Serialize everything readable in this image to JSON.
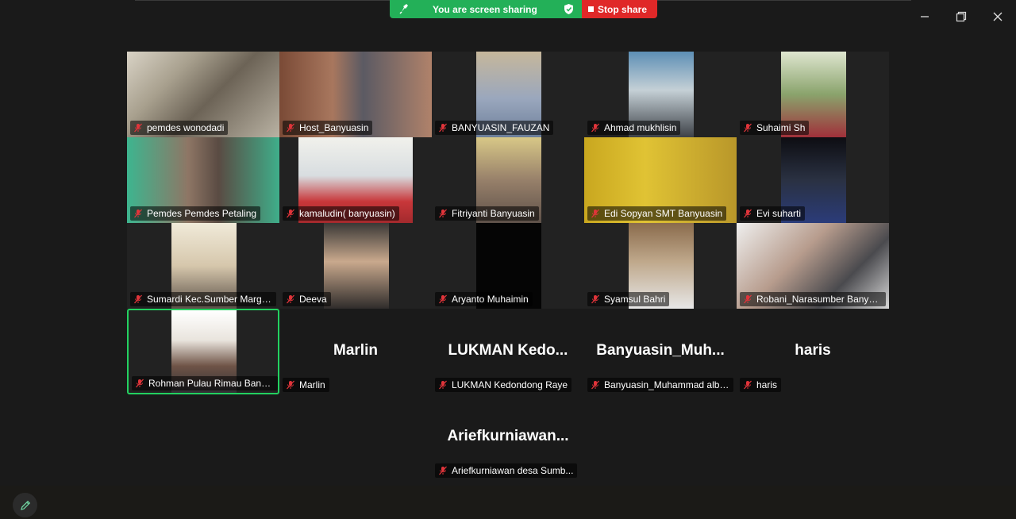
{
  "screen_share": {
    "status_text": "You are screen sharing",
    "stop_label": "Stop share"
  },
  "participants": [
    {
      "label": "pemdes wonodadi"
    },
    {
      "label": "Host_Banyuasin"
    },
    {
      "label": "BANYUASIN_FAUZAN"
    },
    {
      "label": "Ahmad mukhlisin"
    },
    {
      "label": "Suhaimi Sh"
    },
    {
      "label": "Pemdes Pemdes Petaling"
    },
    {
      "label": "kamaludin( banyuasin)"
    },
    {
      "label": "Fitriyanti Banyuasin"
    },
    {
      "label": "Edi Sopyan SMT Banyuasin"
    },
    {
      "label": "Evi suharti"
    },
    {
      "label": "Sumardi Kec.Sumber Marga ..."
    },
    {
      "label": "Deeva"
    },
    {
      "label": "Aryanto Muhaimin"
    },
    {
      "label": "Syamsul Bahri"
    },
    {
      "label": "Robani_Narasumber Banyuasin"
    },
    {
      "label": "Rohman Pulau Rimau Banyu..."
    },
    {
      "big": "Marlin",
      "label": "Marlin"
    },
    {
      "big": "LUKMAN  Kedo...",
      "label": "LUKMAN Kedondong Raye"
    },
    {
      "big": "Banyuasin_Muh...",
      "label": "Banyuasin_Muhammad albu..."
    },
    {
      "big": "haris",
      "label": "haris"
    },
    {
      "big": "Ariefkurniawan...",
      "label": "Ariefkurniawan desa  Sumb..."
    }
  ],
  "colors": {
    "share_green": "#23b058",
    "stop_red": "#e02828",
    "active_speaker": "#23d160",
    "background": "#1a1a1a"
  }
}
